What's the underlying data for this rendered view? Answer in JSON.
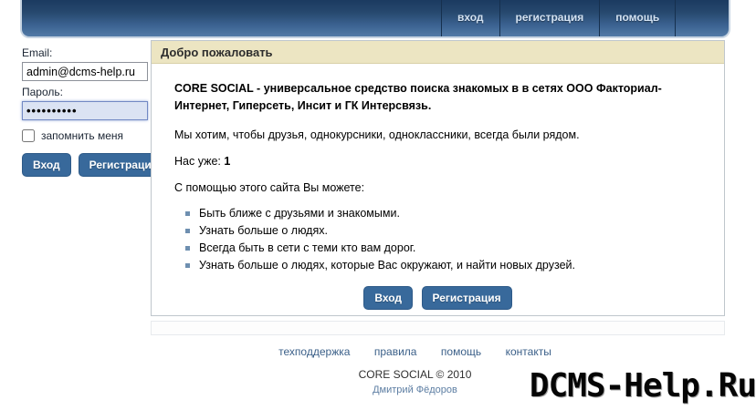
{
  "topbar": {
    "nav": [
      "вход",
      "регистрация",
      "помощь"
    ]
  },
  "login": {
    "email_label": "Email:",
    "email_value": "admin@dcms-help.ru",
    "password_label": "Пароль:",
    "password_value": "••••••••••",
    "remember_label": "запомнить меня",
    "login_button": "Вход",
    "register_button": "Регистрация"
  },
  "main": {
    "header": "Добро пожаловать",
    "intro": "CORE SOCIAL - универсальное средство поиска знакомых в в сетях ООО Факториал-Интернет, Гиперсеть, Инсит и ГК Интерсвязь.",
    "p1": "Мы хотим, чтобы друзья, однокурсники, одноклассники, всегда были рядом.",
    "count_label": "Нас уже: ",
    "count_value": "1",
    "p2": "С помощью этого сайта Вы можете:",
    "bullets": [
      "Быть ближе с друзьями и знакомыми.",
      "Узнать больше о людях.",
      "Всегда быть в сети с теми кто вам дорог.",
      "Узнать больше о людях, которые Вас окружают, и найти новых друзей."
    ],
    "login_button": "Вход",
    "register_button": "Регистрация"
  },
  "footer": {
    "links": [
      "техподдержка",
      "правила",
      "помощь",
      "контакты"
    ],
    "copyright": "CORE SOCIAL © 2010",
    "author": "Дмитрий Фёдоров"
  },
  "watermark": "DCMS-Help.Ru",
  "colors": {
    "topbar_gradient_top": "#1b3a60",
    "topbar_gradient_bottom": "#527aa6",
    "panel_header_bg": "#ece5c2",
    "button_bg": "#38699b",
    "link_blue": "#3a5f88",
    "password_field_bg": "#dbe3f3"
  }
}
